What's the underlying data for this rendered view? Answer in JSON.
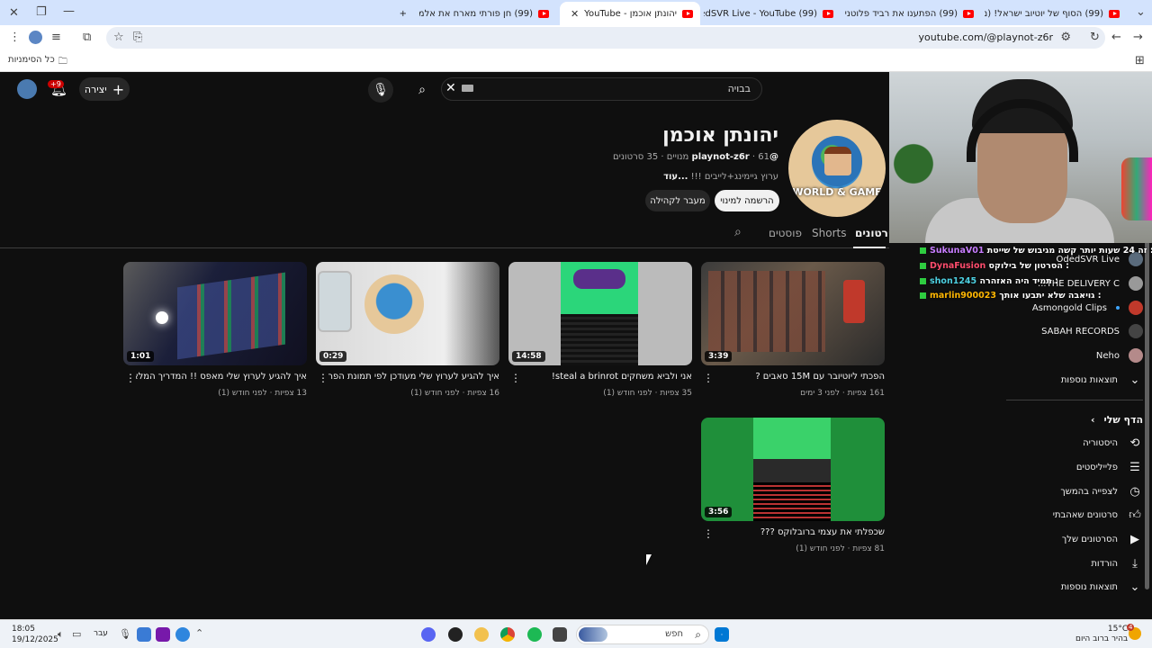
{
  "browser": {
    "tabs": [
      {
        "label": "(99) הסוף של יוטיוב ישראל! (נס"
      },
      {
        "label": "(99) הפתענו את רביד פלוטניק"
      },
      {
        "label": "(99) OdedSVR Live - YouTube"
      },
      {
        "label": "יהונתן אוכמן - YouTube"
      },
      {
        "label": "(99) חן פורתי מארח את אלמוג"
      }
    ],
    "url": "youtube.com/@playnot-z6r",
    "bookmarks_label": "כל הסימניות"
  },
  "header": {
    "search_placeholder": "בבויה",
    "create_label": "יצירה",
    "notifications_badge": "+9"
  },
  "channel": {
    "name": "יהונתן אוכמן",
    "handle": "@playnot-z6r",
    "meta_rest": "· 61 מנויים · 35 סרטונים",
    "description": "ערוץ גיימינג+לייבים !!!",
    "more_label": "...עוד",
    "subscribe_label": "הרשמה למינוי",
    "community_label": "מעבר לקהילה",
    "avatar_text": "WORLD & GAME"
  },
  "channel_tabs": [
    {
      "label": "סרטונים",
      "active": true
    },
    {
      "label": "Shorts",
      "active": false
    },
    {
      "label": "פוסטים",
      "active": false
    }
  ],
  "videos": [
    {
      "title": "הפכתי ליוטיובר עם 15M סאבים ?",
      "meta": "161 צפיות · לפני 3 ימים",
      "duration": "3:39"
    },
    {
      "title": "אני ולביא משחקים steal a brinrot!",
      "meta": "35 צפיות · לפני חודש (1)",
      "duration": "14:58"
    },
    {
      "title": "איך להגיע לערוץ שלי מעודכן לפי תמונת הפרופיל",
      "meta": "16 צפיות · לפני חודש (1)",
      "duration": "0:29"
    },
    {
      "title": "איך להגיע לערוץ שלי מאפס !! המדריך המלא !",
      "meta": "13 צפיות · לפני חודש (1)",
      "duration": "1:01"
    },
    {
      "title": "שכפלתי את עצמי ברובלוקס ???",
      "meta": "81 צפיות · לפני חודש (1)",
      "duration": "3:56"
    }
  ],
  "sidebar": {
    "subscriptions": [
      {
        "label": "OdedSVR Live"
      },
      {
        "label": "THE DELIVERY C..."
      },
      {
        "label": "Asmongold Clips"
      },
      {
        "label": "SABAH RECORDS"
      },
      {
        "label": "Neho"
      }
    ],
    "more_results_1": "תוצאות נוספות",
    "you_header": "הדף שלי",
    "you_items": [
      {
        "label": "היסטוריה"
      },
      {
        "label": "פלייליסטים"
      },
      {
        "label": "לצפייה בהמשך"
      },
      {
        "label": "סרטונים שאהבתי"
      },
      {
        "label": "הסרטונים שלך"
      },
      {
        "label": "הורדות"
      }
    ],
    "more_results_2": "תוצאות נוספות"
  },
  "chat": [
    {
      "name": "SukunaV01",
      "text": "זה 24 שעות יותר קשה מגיבוש של שייטת :",
      "color": "#c77dff"
    },
    {
      "name": "DynaFusion",
      "text": "הסרטון של בילוקס :",
      "color": "#ff4d6d"
    },
    {
      "name": "shon1245",
      "text": "תמיד היה האזהרה :",
      "color": "#4dd0e1"
    },
    {
      "name": "marlin900023",
      "text": "גויאבה שלא יתבעו אותך :",
      "color": "#ffb703"
    }
  ],
  "taskbar": {
    "search_placeholder": "חפש",
    "time": "18:05",
    "date": "19/12/2025",
    "lang": "עבר",
    "temperature": "15°C",
    "weather_desc": "בהיר ברוב היום",
    "weather_badge": "4"
  }
}
